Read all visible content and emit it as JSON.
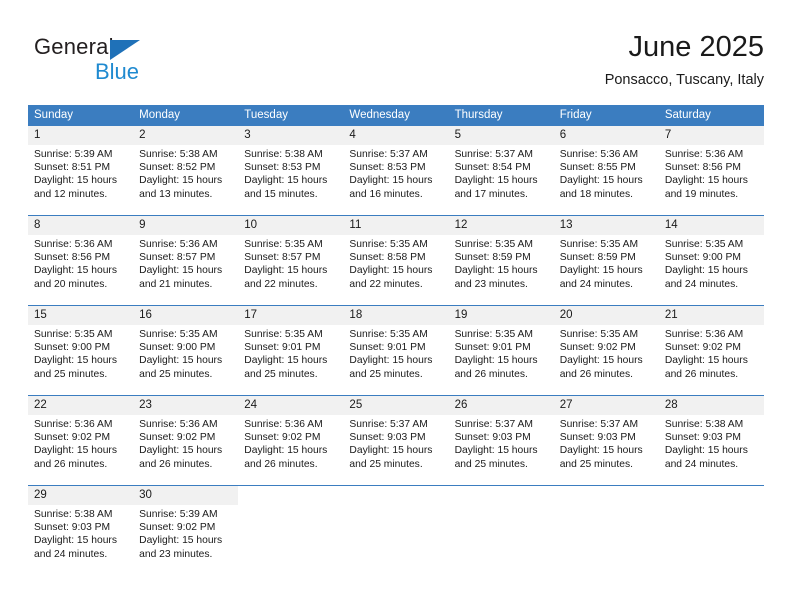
{
  "brand": {
    "name_part1": "General",
    "name_part2": "Blue",
    "triangle_icon": "triangle-icon",
    "colors": {
      "dark": "#231f20",
      "blue": "#1f8ad0",
      "triangle": "#1f71b8"
    }
  },
  "header": {
    "title": "June 2025",
    "subtitle": "Ponsacco, Tuscany, Italy"
  },
  "calendar": {
    "accent_color": "#3b7dc0",
    "daynum_bg": "#f1f1f1",
    "weekday_headers": [
      "Sunday",
      "Monday",
      "Tuesday",
      "Wednesday",
      "Thursday",
      "Friday",
      "Saturday"
    ],
    "weeks": [
      [
        {
          "day": "1",
          "sunrise": "Sunrise: 5:39 AM",
          "sunset": "Sunset: 8:51 PM",
          "daylight_line1": "Daylight: 15 hours",
          "daylight_line2": "and 12 minutes."
        },
        {
          "day": "2",
          "sunrise": "Sunrise: 5:38 AM",
          "sunset": "Sunset: 8:52 PM",
          "daylight_line1": "Daylight: 15 hours",
          "daylight_line2": "and 13 minutes."
        },
        {
          "day": "3",
          "sunrise": "Sunrise: 5:38 AM",
          "sunset": "Sunset: 8:53 PM",
          "daylight_line1": "Daylight: 15 hours",
          "daylight_line2": "and 15 minutes."
        },
        {
          "day": "4",
          "sunrise": "Sunrise: 5:37 AM",
          "sunset": "Sunset: 8:53 PM",
          "daylight_line1": "Daylight: 15 hours",
          "daylight_line2": "and 16 minutes."
        },
        {
          "day": "5",
          "sunrise": "Sunrise: 5:37 AM",
          "sunset": "Sunset: 8:54 PM",
          "daylight_line1": "Daylight: 15 hours",
          "daylight_line2": "and 17 minutes."
        },
        {
          "day": "6",
          "sunrise": "Sunrise: 5:36 AM",
          "sunset": "Sunset: 8:55 PM",
          "daylight_line1": "Daylight: 15 hours",
          "daylight_line2": "and 18 minutes."
        },
        {
          "day": "7",
          "sunrise": "Sunrise: 5:36 AM",
          "sunset": "Sunset: 8:56 PM",
          "daylight_line1": "Daylight: 15 hours",
          "daylight_line2": "and 19 minutes."
        }
      ],
      [
        {
          "day": "8",
          "sunrise": "Sunrise: 5:36 AM",
          "sunset": "Sunset: 8:56 PM",
          "daylight_line1": "Daylight: 15 hours",
          "daylight_line2": "and 20 minutes."
        },
        {
          "day": "9",
          "sunrise": "Sunrise: 5:36 AM",
          "sunset": "Sunset: 8:57 PM",
          "daylight_line1": "Daylight: 15 hours",
          "daylight_line2": "and 21 minutes."
        },
        {
          "day": "10",
          "sunrise": "Sunrise: 5:35 AM",
          "sunset": "Sunset: 8:57 PM",
          "daylight_line1": "Daylight: 15 hours",
          "daylight_line2": "and 22 minutes."
        },
        {
          "day": "11",
          "sunrise": "Sunrise: 5:35 AM",
          "sunset": "Sunset: 8:58 PM",
          "daylight_line1": "Daylight: 15 hours",
          "daylight_line2": "and 22 minutes."
        },
        {
          "day": "12",
          "sunrise": "Sunrise: 5:35 AM",
          "sunset": "Sunset: 8:59 PM",
          "daylight_line1": "Daylight: 15 hours",
          "daylight_line2": "and 23 minutes."
        },
        {
          "day": "13",
          "sunrise": "Sunrise: 5:35 AM",
          "sunset": "Sunset: 8:59 PM",
          "daylight_line1": "Daylight: 15 hours",
          "daylight_line2": "and 24 minutes."
        },
        {
          "day": "14",
          "sunrise": "Sunrise: 5:35 AM",
          "sunset": "Sunset: 9:00 PM",
          "daylight_line1": "Daylight: 15 hours",
          "daylight_line2": "and 24 minutes."
        }
      ],
      [
        {
          "day": "15",
          "sunrise": "Sunrise: 5:35 AM",
          "sunset": "Sunset: 9:00 PM",
          "daylight_line1": "Daylight: 15 hours",
          "daylight_line2": "and 25 minutes."
        },
        {
          "day": "16",
          "sunrise": "Sunrise: 5:35 AM",
          "sunset": "Sunset: 9:00 PM",
          "daylight_line1": "Daylight: 15 hours",
          "daylight_line2": "and 25 minutes."
        },
        {
          "day": "17",
          "sunrise": "Sunrise: 5:35 AM",
          "sunset": "Sunset: 9:01 PM",
          "daylight_line1": "Daylight: 15 hours",
          "daylight_line2": "and 25 minutes."
        },
        {
          "day": "18",
          "sunrise": "Sunrise: 5:35 AM",
          "sunset": "Sunset: 9:01 PM",
          "daylight_line1": "Daylight: 15 hours",
          "daylight_line2": "and 25 minutes."
        },
        {
          "day": "19",
          "sunrise": "Sunrise: 5:35 AM",
          "sunset": "Sunset: 9:01 PM",
          "daylight_line1": "Daylight: 15 hours",
          "daylight_line2": "and 26 minutes."
        },
        {
          "day": "20",
          "sunrise": "Sunrise: 5:35 AM",
          "sunset": "Sunset: 9:02 PM",
          "daylight_line1": "Daylight: 15 hours",
          "daylight_line2": "and 26 minutes."
        },
        {
          "day": "21",
          "sunrise": "Sunrise: 5:36 AM",
          "sunset": "Sunset: 9:02 PM",
          "daylight_line1": "Daylight: 15 hours",
          "daylight_line2": "and 26 minutes."
        }
      ],
      [
        {
          "day": "22",
          "sunrise": "Sunrise: 5:36 AM",
          "sunset": "Sunset: 9:02 PM",
          "daylight_line1": "Daylight: 15 hours",
          "daylight_line2": "and 26 minutes."
        },
        {
          "day": "23",
          "sunrise": "Sunrise: 5:36 AM",
          "sunset": "Sunset: 9:02 PM",
          "daylight_line1": "Daylight: 15 hours",
          "daylight_line2": "and 26 minutes."
        },
        {
          "day": "24",
          "sunrise": "Sunrise: 5:36 AM",
          "sunset": "Sunset: 9:02 PM",
          "daylight_line1": "Daylight: 15 hours",
          "daylight_line2": "and 26 minutes."
        },
        {
          "day": "25",
          "sunrise": "Sunrise: 5:37 AM",
          "sunset": "Sunset: 9:03 PM",
          "daylight_line1": "Daylight: 15 hours",
          "daylight_line2": "and 25 minutes."
        },
        {
          "day": "26",
          "sunrise": "Sunrise: 5:37 AM",
          "sunset": "Sunset: 9:03 PM",
          "daylight_line1": "Daylight: 15 hours",
          "daylight_line2": "and 25 minutes."
        },
        {
          "day": "27",
          "sunrise": "Sunrise: 5:37 AM",
          "sunset": "Sunset: 9:03 PM",
          "daylight_line1": "Daylight: 15 hours",
          "daylight_line2": "and 25 minutes."
        },
        {
          "day": "28",
          "sunrise": "Sunrise: 5:38 AM",
          "sunset": "Sunset: 9:03 PM",
          "daylight_line1": "Daylight: 15 hours",
          "daylight_line2": "and 24 minutes."
        }
      ],
      [
        {
          "day": "29",
          "sunrise": "Sunrise: 5:38 AM",
          "sunset": "Sunset: 9:03 PM",
          "daylight_line1": "Daylight: 15 hours",
          "daylight_line2": "and 24 minutes."
        },
        {
          "day": "30",
          "sunrise": "Sunrise: 5:39 AM",
          "sunset": "Sunset: 9:02 PM",
          "daylight_line1": "Daylight: 15 hours",
          "daylight_line2": "and 23 minutes."
        },
        {
          "day": "",
          "sunrise": "",
          "sunset": "",
          "daylight_line1": "",
          "daylight_line2": ""
        },
        {
          "day": "",
          "sunrise": "",
          "sunset": "",
          "daylight_line1": "",
          "daylight_line2": ""
        },
        {
          "day": "",
          "sunrise": "",
          "sunset": "",
          "daylight_line1": "",
          "daylight_line2": ""
        },
        {
          "day": "",
          "sunrise": "",
          "sunset": "",
          "daylight_line1": "",
          "daylight_line2": ""
        },
        {
          "day": "",
          "sunrise": "",
          "sunset": "",
          "daylight_line1": "",
          "daylight_line2": ""
        }
      ]
    ]
  }
}
